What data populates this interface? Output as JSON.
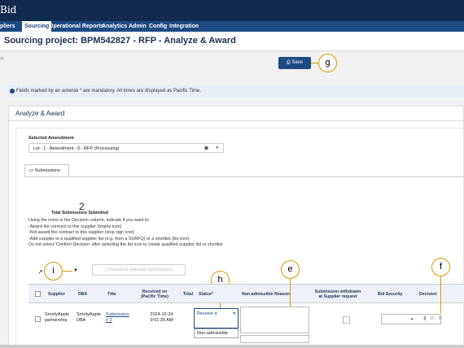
{
  "app": {
    "title": "Bid"
  },
  "nav": {
    "items": [
      "pliers",
      "Sourcing",
      "Operational Reports",
      "Analytics",
      "Admin",
      "Config",
      "Integration"
    ],
    "active": "Sourcing"
  },
  "page": {
    "title": "Sourcing project: BPM542827 - RFP - Analyze & Award",
    "left_marker": "«"
  },
  "toolbar": {
    "save_label": "Save",
    "save_icon": "⎙"
  },
  "info": {
    "text": "Fields marked by an asterisk * are mandatory. All times are displayed as Pacific Time."
  },
  "section": {
    "title": "Analyze & Award"
  },
  "amendment": {
    "label": "Selected Amendment",
    "value": "Lot : 1 - Amendment : 0 - RFP (Processing)"
  },
  "tabs": {
    "submissions": "Submissions"
  },
  "summary": {
    "count": "2",
    "label": "Total Submissions Submitted"
  },
  "instructions": [
    "Using the icons in the Decision column, indicate if you want to:",
    "-Award the contract to this supplier (trophy icon)",
    "-Not award the contract to this supplier (stop sign icon)",
    "-Add supplier to a qualified supplier list (e.g. from a SURFQ) or a shortlist (list icon)",
    "Do not select 'Confirm Decision' after selecting the list icon to create qualified supplier list or shortlist"
  ],
  "download": {
    "label": "Download selected Submissions"
  },
  "table": {
    "headers": [
      "Supplier",
      "DBA",
      "Title",
      "Received on (Pacific Time)",
      "Total",
      "Status*",
      "Non-admissible Reason",
      "Submission withdrawn at Supplier request",
      "Bid Security",
      "Decision"
    ],
    "rows": [
      {
        "supplier": "SnortyApple partnership",
        "dba": "SnortyApple DBA",
        "title": "Submission # 2",
        "received": "2024-10-24 9:01:39 AM",
        "status": "Receive d",
        "status_option": "Non-admissible"
      }
    ]
  },
  "callouts": {
    "g": "g",
    "h": "h",
    "e": "e",
    "f": "f",
    "i": "i"
  },
  "colors": {
    "navy": "#112b4e",
    "accent": "#1d4a80",
    "callout": "#d69a00"
  }
}
